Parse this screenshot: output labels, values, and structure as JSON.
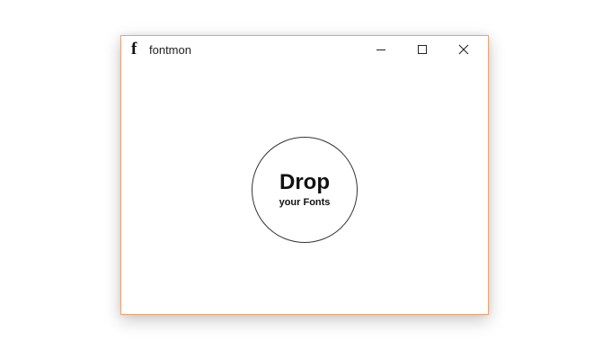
{
  "window": {
    "app_icon_glyph": "f",
    "title": "fontmon",
    "accent_border": "#f0a070",
    "controls": {
      "minimize": "minimize-icon",
      "maximize": "maximize-icon",
      "close": "close-icon"
    }
  },
  "drop_zone": {
    "heading": "Drop",
    "subheading": "your Fonts"
  }
}
